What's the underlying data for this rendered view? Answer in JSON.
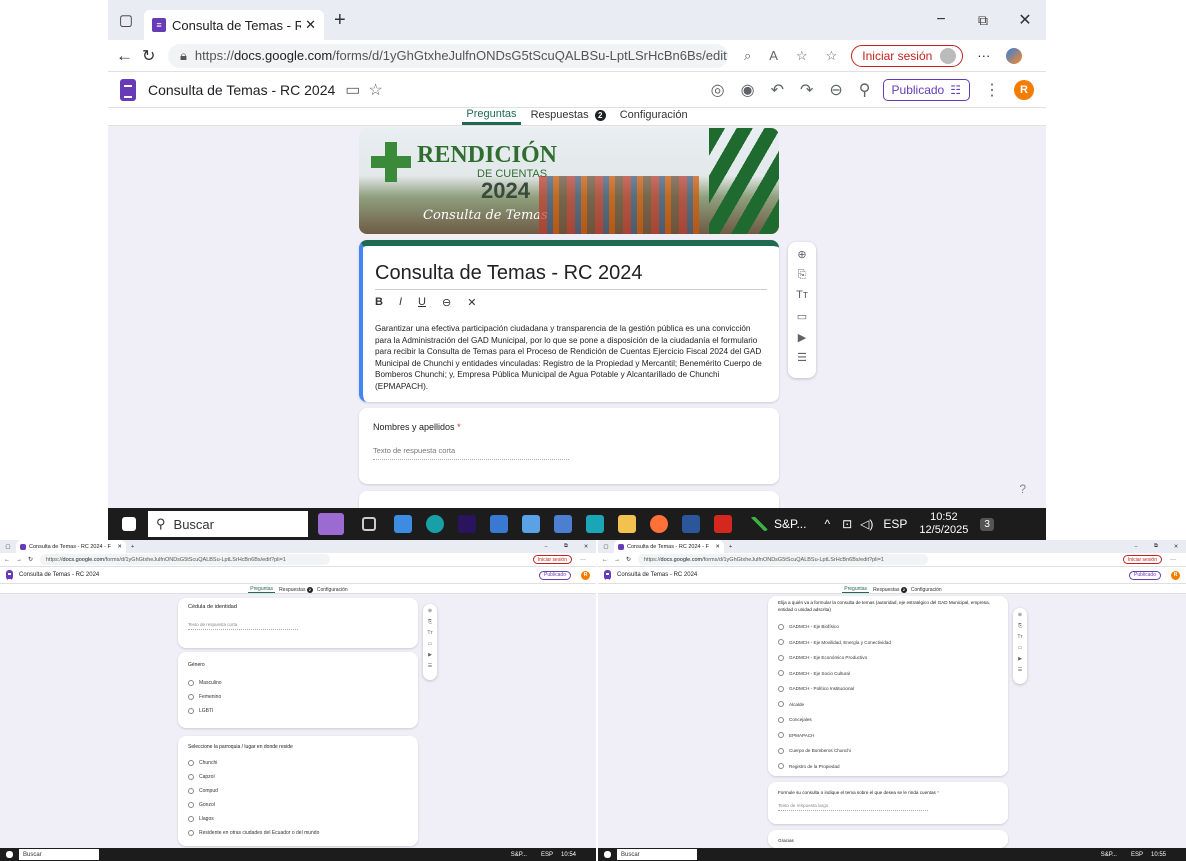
{
  "browser": {
    "tab_title": "Consulta de Temas - RC 2024 - Fo",
    "tab_title_short": "Consulta de Temas - RC 2024 - F",
    "new_tab": "+",
    "url_prefix": "https://",
    "url_domain": "docs.google.com",
    "url_path": "/forms/d/1yGhGtxheJulfnONDsG5tScuQALBSu-LptLSrHcBn6Bs/edit?pli=1",
    "signin_label": "Iniciar sesión",
    "more": "···"
  },
  "form_header": {
    "title": "Consulta de Temas - RC 2024",
    "publish_label": "Publicado",
    "user_initial": "R"
  },
  "form_tabs": {
    "questions": "Preguntas",
    "responses": "Respuestas",
    "responses_count": "2",
    "settings": "Configuración"
  },
  "banner": {
    "headline": "RENDICIÓN",
    "subhead": "DE CUENTAS",
    "year": "2024",
    "script": "Consulta de Temas"
  },
  "title_card": {
    "title": "Consulta de Temas - RC 2024",
    "toolbar": [
      "B",
      "I",
      "U",
      "⊖",
      "✕"
    ],
    "description": "Garantizar una efectiva participación ciudadana y transparencia de la gestión pública es una convicción para la Administración del GAD Municipal, por lo que se pone a disposición de la ciudadanía el formulario para recibir la Consulta de Temas para el Proceso de Rendición de Cuentas Ejercicio Fiscal 2024 del GAD Municipal de Chunchi y entidades vinculadas: Registro de la Propiedad y Mercantil; Benemérito Cuerpo de Bomberos Chunchi; y, Empresa Pública Municipal de Agua Potable y Alcantarillado de Chunchi (EPMAPACH)."
  },
  "q_name": {
    "label": "Nombres y apellidos",
    "required": "*",
    "placeholder": "Texto de respuesta corta"
  },
  "side_tools": [
    "⊕",
    "⎘",
    "Tт",
    "▭",
    "▶",
    "☰"
  ],
  "taskbar": {
    "search": "Buscar",
    "sp_label": "S&P...",
    "lang": "ESP",
    "time": "10:52",
    "date": "12/5/2025",
    "notif": "3",
    "time2": "10:54",
    "time3": "10:55"
  },
  "shot2": {
    "q_cedula": {
      "label": "Cédula de identidad",
      "placeholder": "Texto de respuesta corta"
    },
    "q_genero": {
      "label": "Género",
      "options": [
        "Masculino",
        "Femenino",
        "LGBTI"
      ]
    },
    "q_parroquia": {
      "label": "Seleccione la parroquia / lugar en donde reside",
      "options": [
        "Chunchi",
        "Capzol",
        "Compud",
        "Gonzol",
        "Llagos",
        "Residente en otras ciudades del Ecuador o del mundo"
      ]
    }
  },
  "shot3": {
    "q_entidad": {
      "label": "Elija a quién va a formular la consulta de temas (autoridad, eje estratégico del GAD Municipal, empresa, entidad o unidad adscrita)",
      "options": [
        "GADMCH - Eje Biofísico",
        "GADMCH - Eje Movilidad, Energía y Conectividad",
        "GADMCH - Eje Económico Productivo",
        "GADMCH - Eje Socio Cultural",
        "GADMCH - Político Institucional",
        "Alcalde",
        "Concejales",
        "EPMAPACH",
        "Cuerpo de Bomberos Chunchi",
        "Registro de la Propiedad"
      ]
    },
    "q_consulta": {
      "label": "Formule su consulta o indique el tema sobre el que desea se le rinda cuentas",
      "required": "*",
      "placeholder": "Texto de respuesta largo"
    },
    "q_gracias": {
      "label": "Gracias"
    }
  },
  "colors": {
    "accent": "#673ab7",
    "brand_green": "#1e6b52",
    "required": "#d93025",
    "signin": "#c5221f"
  }
}
